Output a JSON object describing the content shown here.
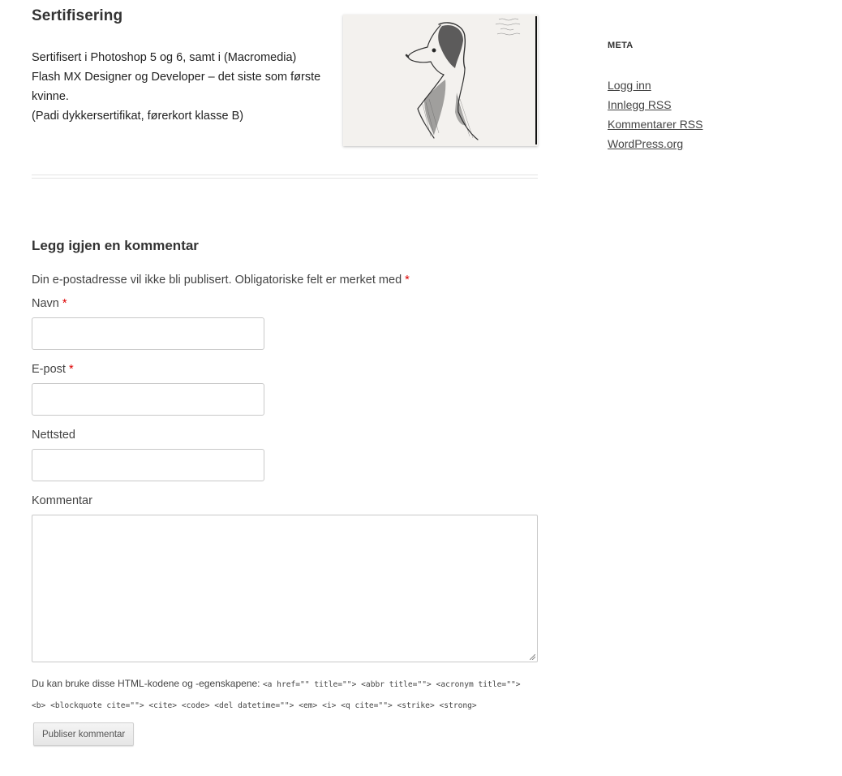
{
  "certification": {
    "title": "Sertifisering",
    "lines": [
      "Sertifisert i Photoshop 5 og 6, samt i (Macromedia)",
      "Flash MX Designer og Developer – det siste som første",
      "kvinne.",
      "(Padi dykkersertifikat, førerkort klasse B)"
    ],
    "image_icon": "dog-sketch-drawing"
  },
  "reply": {
    "title": "Legg igjen en kommentar",
    "notes": "Din e-postadresse vil ikke bli publisert. Obligatoriske felt er merket med",
    "required_mark": "*",
    "fields": {
      "name_label": "Navn",
      "email_label": "E-post",
      "url_label": "Nettsted",
      "comment_label": "Kommentar",
      "name_value": "",
      "email_value": "",
      "url_value": "",
      "comment_value": ""
    },
    "allowed_intro": "Du kan bruke disse HTML-kodene og -egenskapene:",
    "allowed_tags_line1": "<a href=\"\" title=\"\"> <abbr title=\"\"> <acronym title=\"\">",
    "allowed_tags_line2": "<b> <blockquote cite=\"\"> <cite> <code> <del datetime=\"\"> <em> <i> <q cite=\"\"> <strike> <strong>",
    "submit_label": "Publiser kommentar"
  },
  "sidebar": {
    "meta_title": "META",
    "links": [
      "Logg inn",
      "Innlegg RSS",
      "Kommentarer RSS",
      "WordPress.org"
    ]
  },
  "colors": {
    "required": "#dd0000",
    "text": "#444444"
  }
}
